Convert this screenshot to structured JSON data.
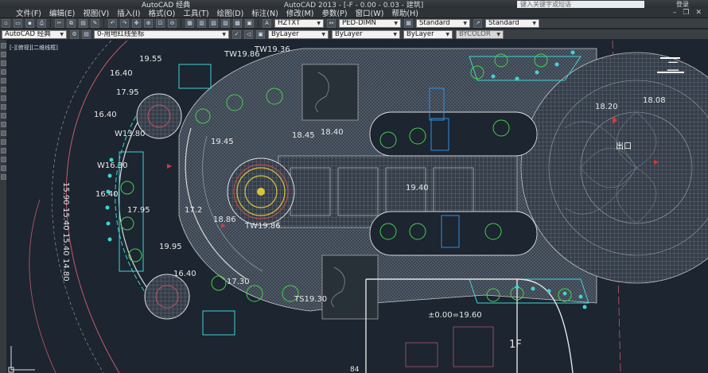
{
  "window": {
    "app_title": "AutoCAD 经典",
    "doc_title": "AutoCAD 2013  -  [-F - 0.00 - 0.03 - 建筑]",
    "search_placeholder": "键入关键字或短语",
    "user_label": "登录"
  },
  "menu": [
    {
      "label": "文件(F)"
    },
    {
      "label": "编辑(E)"
    },
    {
      "label": "视图(V)"
    },
    {
      "label": "插入(I)"
    },
    {
      "label": "格式(O)"
    },
    {
      "label": "工具(T)"
    },
    {
      "label": "绘图(D)"
    },
    {
      "label": "标注(N)"
    },
    {
      "label": "修改(M)"
    },
    {
      "label": "参数(P)"
    },
    {
      "label": "窗口(W)"
    },
    {
      "label": "帮助(H)"
    }
  ],
  "toolbar1": {
    "text_style": "HZTXT",
    "dim_style": "PED-DIMN",
    "table_style": "Standard",
    "mleader_style": "Standard"
  },
  "toolbar2": {
    "workspace": "AutoCAD 经典",
    "layer": "0-用地红线坐标",
    "color": "ByLayer",
    "linetype": "ByLayer",
    "lineweight": "ByLayer",
    "plotstyle": "BYCOLOR"
  },
  "viewport": {
    "label": "[-][俯视][二维线框]"
  },
  "drawing": {
    "elevations": [
      {
        "text": "TW19.86"
      },
      {
        "text": "19.55"
      },
      {
        "text": "16.40"
      },
      {
        "text": "17.95"
      },
      {
        "text": "16.40"
      },
      {
        "text": "W13.80"
      },
      {
        "text": "W16.30"
      },
      {
        "text": "16.40"
      },
      {
        "text": "17.95"
      },
      {
        "text": "19.95"
      },
      {
        "text": "16.40"
      },
      {
        "text": "17.30"
      },
      {
        "text": "TS19.30"
      },
      {
        "text": "TW19.86"
      },
      {
        "text": "TW19.36"
      },
      {
        "text": "18.45"
      },
      {
        "text": "18.40"
      },
      {
        "text": "19.45"
      },
      {
        "text": "17.2"
      },
      {
        "text": "18.86"
      },
      {
        "text": "19.40"
      },
      {
        "text": "18.20"
      },
      {
        "text": "18.08"
      },
      {
        "text": "15.90"
      },
      {
        "text": "15.40"
      },
      {
        "text": "15.40"
      },
      {
        "text": "14.80"
      },
      {
        "text": "±0.00=19.60"
      },
      {
        "text": "1F"
      },
      {
        "text": "二"
      },
      {
        "text": "出口"
      },
      {
        "text": "84"
      }
    ]
  }
}
